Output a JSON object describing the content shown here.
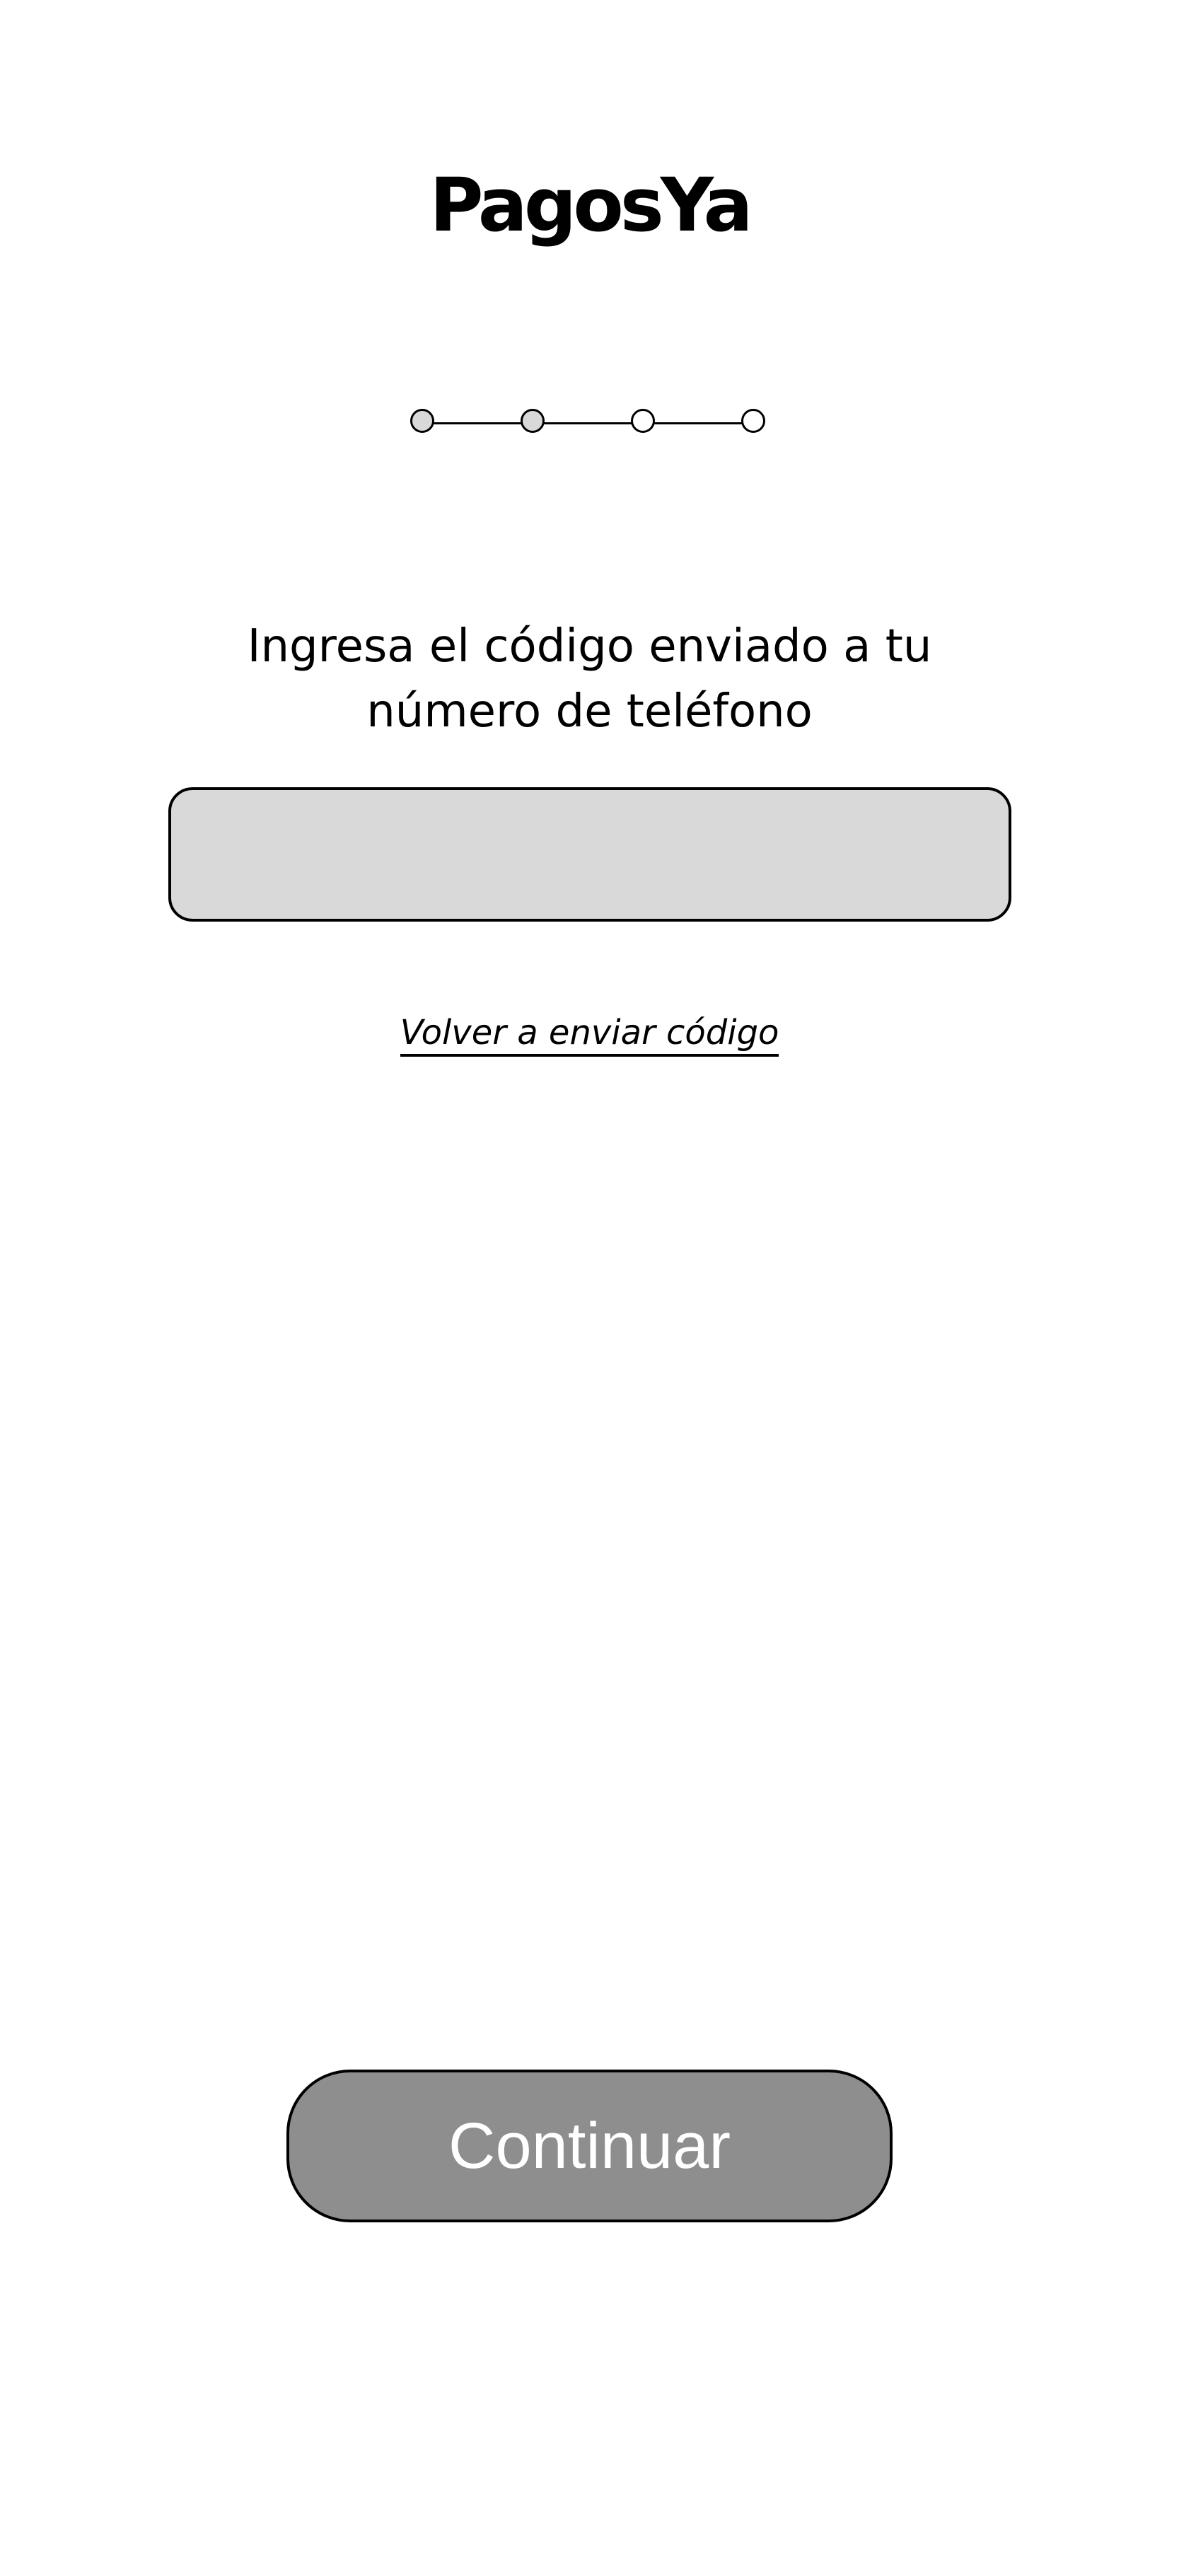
{
  "header": {
    "logo_text": "PagosYa"
  },
  "stepper": {
    "total_steps": 4,
    "completed_steps": 2,
    "colors": {
      "completed": "#d9d9d9",
      "pending": "#ffffff"
    }
  },
  "verification": {
    "prompt": "Ingresa el código enviado a tu número de teléfono",
    "code_input": {
      "value": "",
      "placeholder": ""
    },
    "resend_link": "Volver a enviar código"
  },
  "footer": {
    "continue_label": "Continuar",
    "button_color": "#8e8e8e"
  }
}
